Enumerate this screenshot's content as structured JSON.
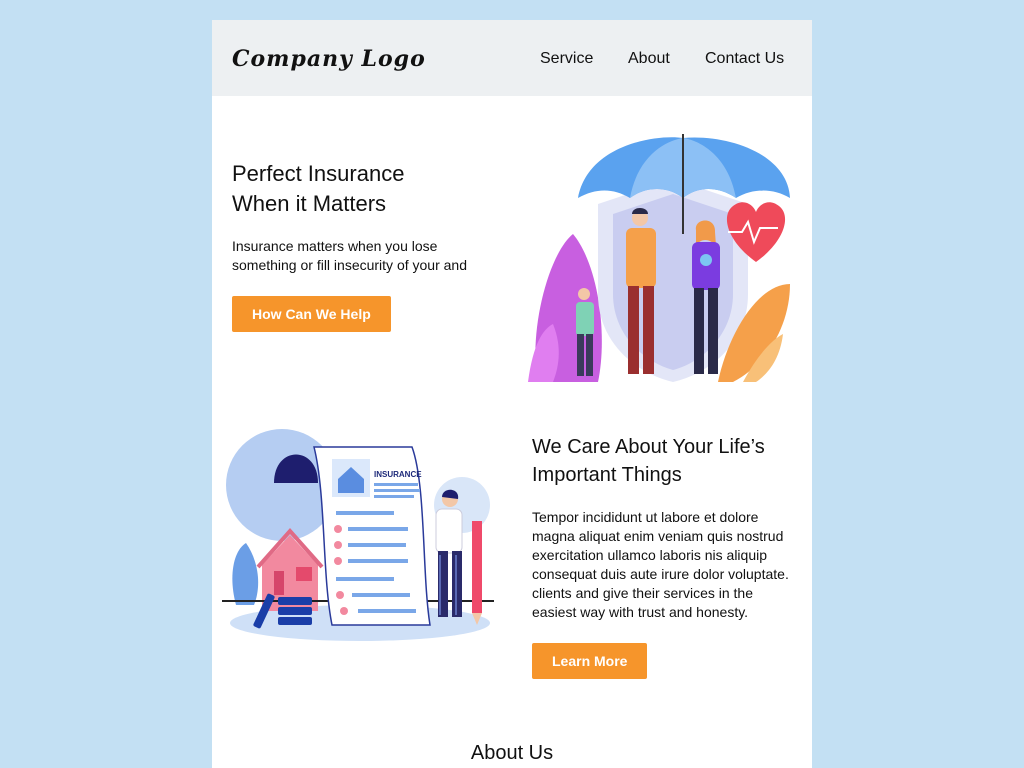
{
  "header": {
    "logo": "Company Logo",
    "nav": [
      "Service",
      "About",
      "Contact Us"
    ]
  },
  "hero": {
    "title_line1": "Perfect Insurance",
    "title_line2": "When it Matters",
    "text_line1": "Insurance matters when you lose",
    "text_line2": "something or fill insecurity of your and",
    "button": "How Can We Help"
  },
  "care": {
    "title_line1": "We Care About Your Life’s",
    "title_line2": "Important Things",
    "text_lines": [
      "Tempor incididunt ut labore et dolore",
      "magna aliquat enim veniam quis nostrud",
      "exercitation ullamco laboris nis aliquip",
      "consequat duis aute irure dolor voluptate.",
      "clients and give their services in the",
      "easiest way with trust and honesty."
    ],
    "button": "Learn More"
  },
  "document_label": "INSURANCE",
  "about": {
    "heading": "About Us"
  },
  "colors": {
    "accent": "#f6952b",
    "page_bg": "#c3e0f3",
    "header_bg": "#edf0f2"
  }
}
